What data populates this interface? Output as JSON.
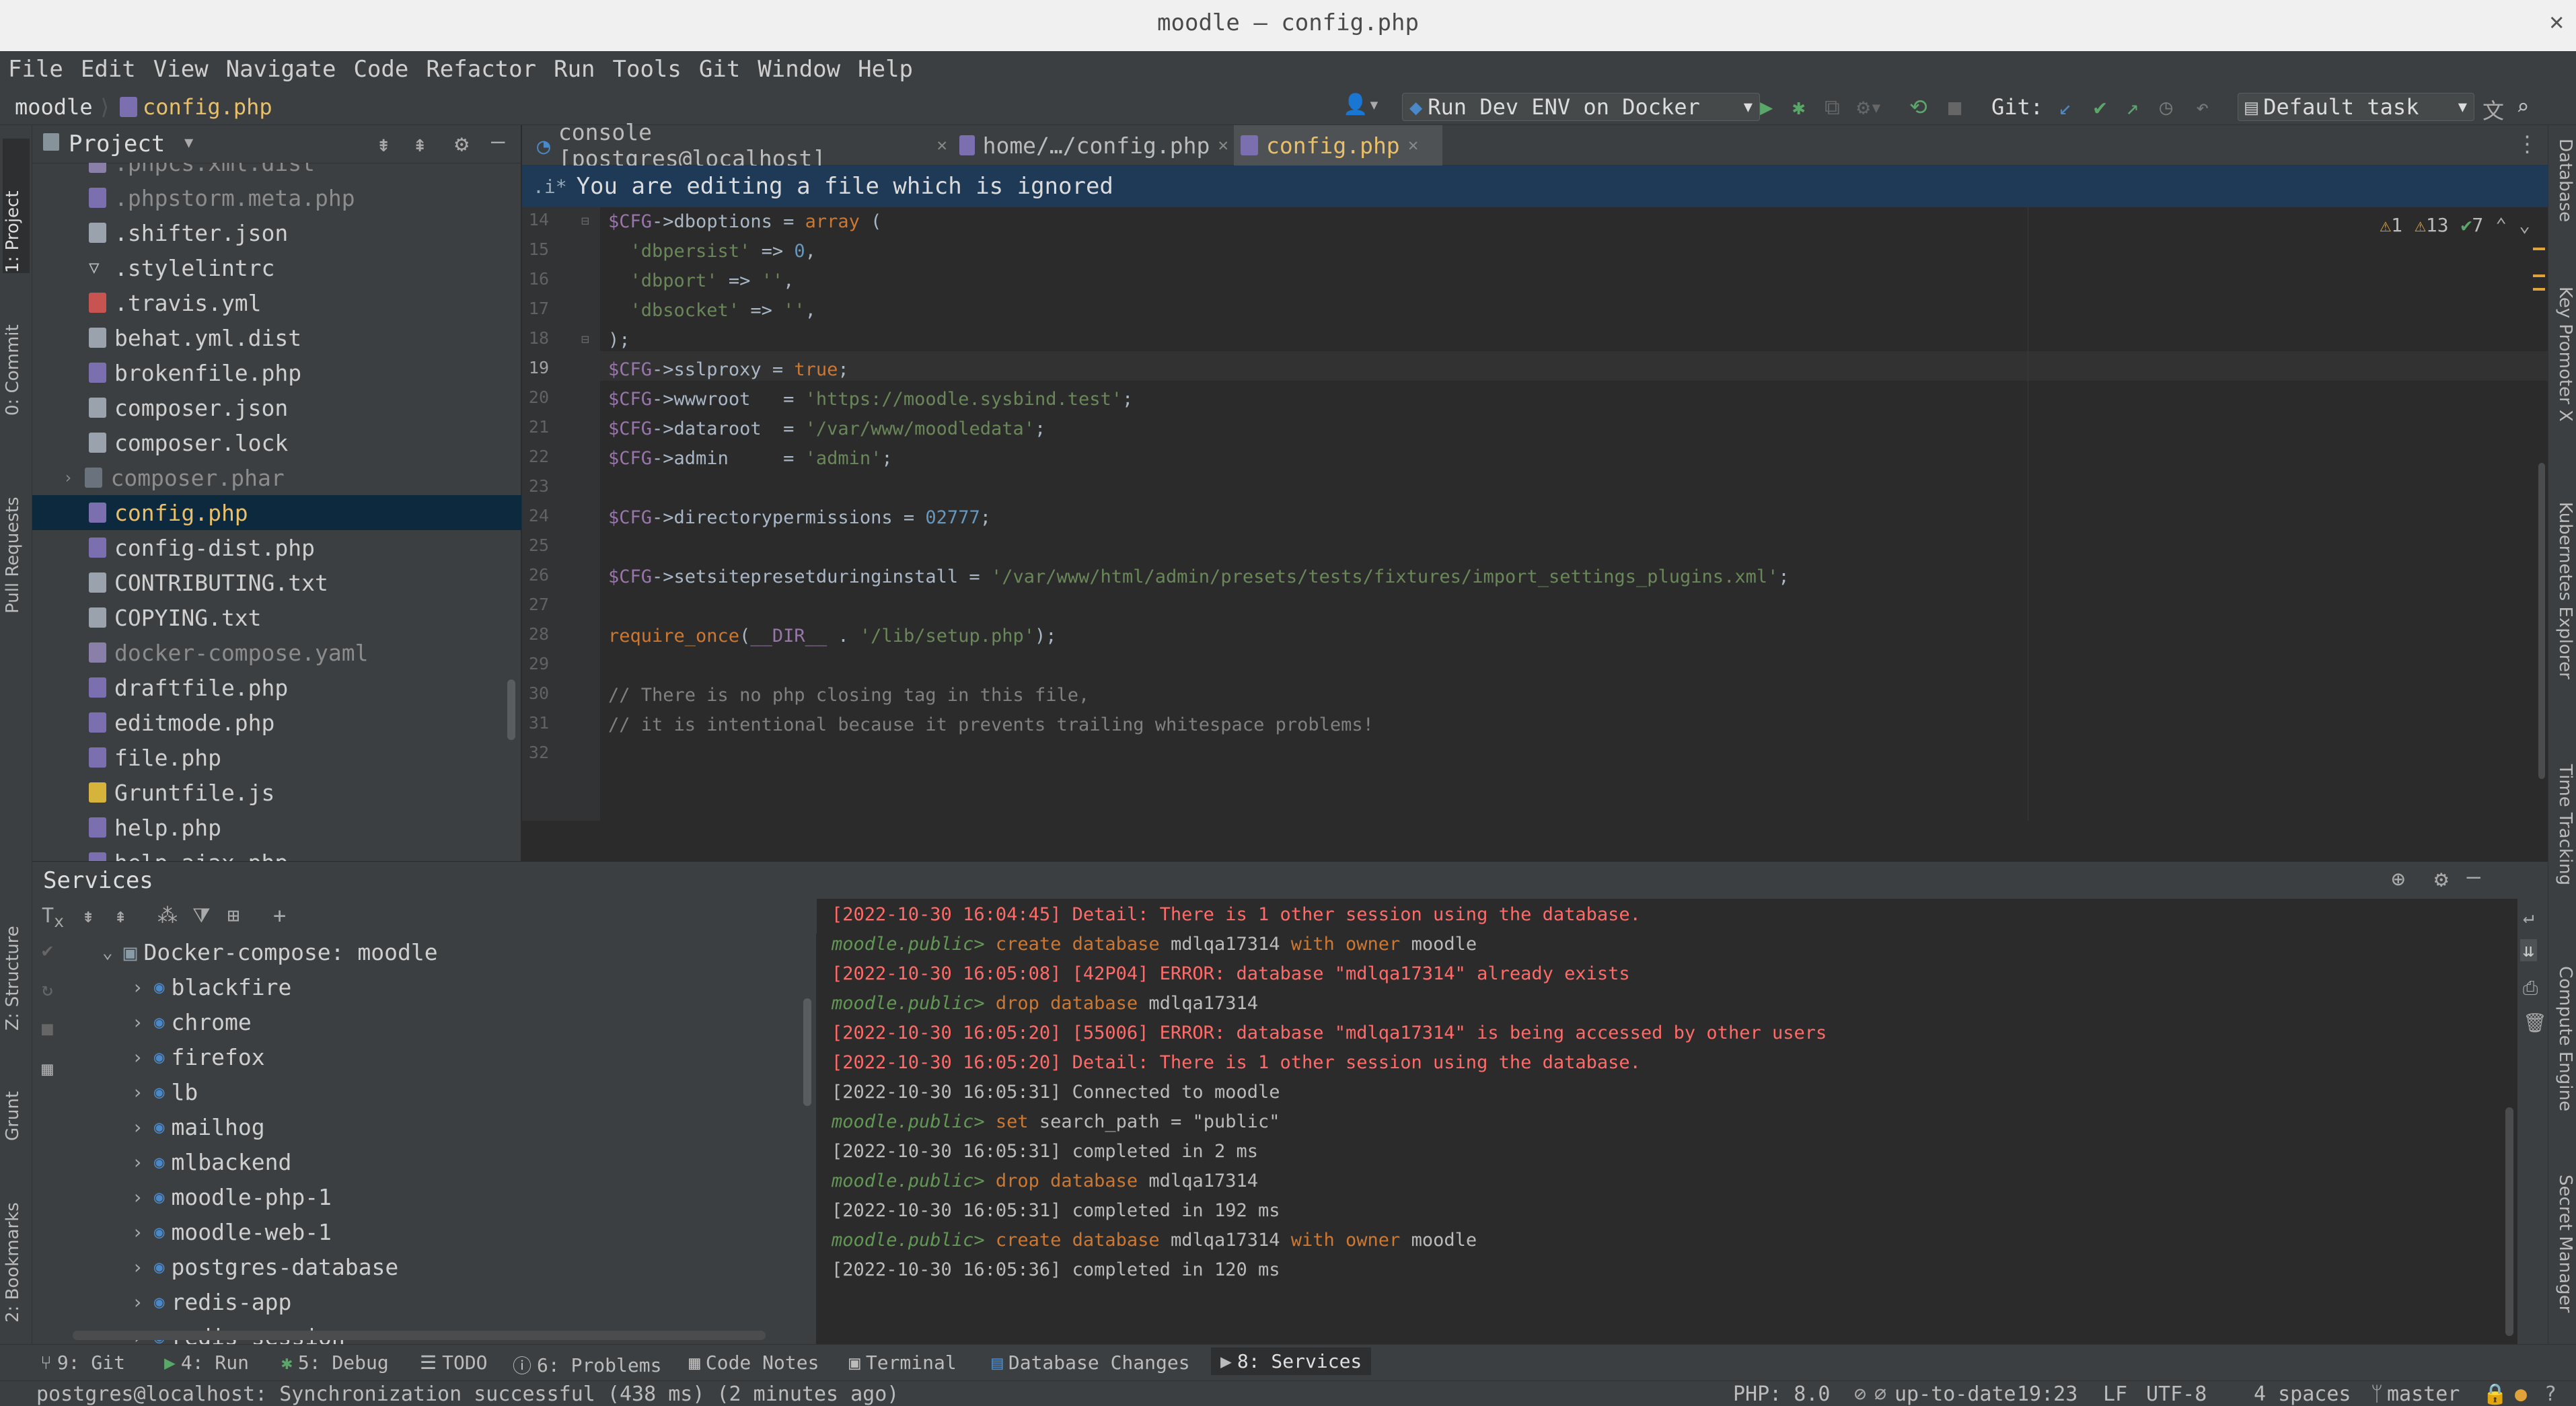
{
  "window": {
    "title": "moodle – config.php",
    "close": "✕"
  },
  "menu": [
    "File",
    "Edit",
    "View",
    "Navigate",
    "Code",
    "Refactor",
    "Run",
    "Tools",
    "Git",
    "Window",
    "Help"
  ],
  "nav": {
    "breadcrumb_root": "moodle",
    "breadcrumb_file": "config.php",
    "run_config": "Run Dev ENV on Docker",
    "git_label": "Git:",
    "task": "Default task"
  },
  "left_tool_tabs": [
    "1: Project",
    "0: Commit",
    "Pull Requests",
    "Z: Structure",
    "Grunt",
    "2: Bookmarks"
  ],
  "right_tool_tabs": [
    "Database",
    "Key Promoter X",
    "Kubernetes Explorer",
    "Time Tracking",
    "Compute Engine",
    "Secret Manager"
  ],
  "project": {
    "title": "Project",
    "files": [
      {
        "name": ".phpcs.xml.dist",
        "dim": true
      },
      {
        "name": ".phpstorm.meta.php",
        "dim": true
      },
      {
        "name": ".shifter.json",
        "dim": false
      },
      {
        "name": ".stylelintrc",
        "dim": false
      },
      {
        "name": ".travis.yml",
        "dim": false
      },
      {
        "name": "behat.yml.dist",
        "dim": false
      },
      {
        "name": "brokenfile.php",
        "dim": false
      },
      {
        "name": "composer.json",
        "dim": false
      },
      {
        "name": "composer.lock",
        "dim": false
      },
      {
        "name": "composer.phar",
        "dim": true
      },
      {
        "name": "config.php",
        "dim": false,
        "selected": true
      },
      {
        "name": "config-dist.php",
        "dim": false
      },
      {
        "name": "CONTRIBUTING.txt",
        "dim": false
      },
      {
        "name": "COPYING.txt",
        "dim": false
      },
      {
        "name": "docker-compose.yaml",
        "dim": true
      },
      {
        "name": "draftfile.php",
        "dim": false
      },
      {
        "name": "editmode.php",
        "dim": false
      },
      {
        "name": "file.php",
        "dim": false
      },
      {
        "name": "Gruntfile.js",
        "dim": false
      },
      {
        "name": "help.php",
        "dim": false
      },
      {
        "name": "help_ajax.php",
        "dim": false
      }
    ]
  },
  "editor": {
    "tabs": [
      {
        "label": "console [postgres@localhost]",
        "active": false
      },
      {
        "label": "home/…/config.php",
        "active": false
      },
      {
        "label": "config.php",
        "active": true
      }
    ],
    "banner": "You are editing a file which is ignored",
    "inspections": {
      "errors": "1",
      "warnings": "13",
      "ok": "7"
    },
    "lines": [
      {
        "n": "14",
        "code": [
          [
            "v",
            "$CFG"
          ],
          [
            "p",
            "->"
          ],
          [
            "p",
            "dboptions = "
          ],
          [
            "k",
            "array"
          ],
          [
            "p",
            " ("
          ]
        ]
      },
      {
        "n": "15",
        "code": [
          [
            "p",
            "  "
          ],
          [
            "s",
            "'dbpersist'"
          ],
          [
            "p",
            " => "
          ],
          [
            "n",
            "0"
          ],
          [
            "p",
            ","
          ]
        ]
      },
      {
        "n": "16",
        "code": [
          [
            "p",
            "  "
          ],
          [
            "s",
            "'dbport'"
          ],
          [
            "p",
            " => "
          ],
          [
            "s",
            "''"
          ],
          [
            "p",
            ","
          ]
        ]
      },
      {
        "n": "17",
        "code": [
          [
            "p",
            "  "
          ],
          [
            "s",
            "'dbsocket'"
          ],
          [
            "p",
            " => "
          ],
          [
            "s",
            "''"
          ],
          [
            "p",
            ","
          ]
        ]
      },
      {
        "n": "18",
        "code": [
          [
            "p",
            ");"
          ]
        ]
      },
      {
        "n": "19",
        "code": [
          [
            "v",
            "$CFG"
          ],
          [
            "p",
            "->sslproxy = "
          ],
          [
            "k",
            "true"
          ],
          [
            "p",
            ";"
          ]
        ]
      },
      {
        "n": "20",
        "code": [
          [
            "v",
            "$CFG"
          ],
          [
            "p",
            "->wwwroot   = "
          ],
          [
            "s",
            "'https://moodle.sysbind.test'"
          ],
          [
            "p",
            ";"
          ]
        ]
      },
      {
        "n": "21",
        "code": [
          [
            "v",
            "$CFG"
          ],
          [
            "p",
            "->dataroot  = "
          ],
          [
            "s",
            "'/var/www/moodledata'"
          ],
          [
            "p",
            ";"
          ]
        ]
      },
      {
        "n": "22",
        "code": [
          [
            "v",
            "$CFG"
          ],
          [
            "p",
            "->admin     = "
          ],
          [
            "s",
            "'admin'"
          ],
          [
            "p",
            ";"
          ]
        ]
      },
      {
        "n": "23",
        "code": []
      },
      {
        "n": "24",
        "code": [
          [
            "v",
            "$CFG"
          ],
          [
            "p",
            "->directorypermissions = "
          ],
          [
            "n",
            "02777"
          ],
          [
            "p",
            ";"
          ]
        ]
      },
      {
        "n": "25",
        "code": []
      },
      {
        "n": "26",
        "code": [
          [
            "v",
            "$CFG"
          ],
          [
            "p",
            "->setsitepresetduringinstall = "
          ],
          [
            "s",
            "'/var/www/html/admin/presets/tests/fixtures/import_settings_plugins.xml'"
          ],
          [
            "p",
            ";"
          ]
        ]
      },
      {
        "n": "27",
        "code": []
      },
      {
        "n": "28",
        "code": [
          [
            "k",
            "require_once"
          ],
          [
            "p",
            "("
          ],
          [
            "v",
            "__DIR__"
          ],
          [
            "p",
            " . "
          ],
          [
            "s",
            "'/lib/setup.php'"
          ],
          [
            "p",
            ");"
          ]
        ]
      },
      {
        "n": "29",
        "code": []
      },
      {
        "n": "30",
        "code": [
          [
            "c",
            "// There is no php closing tag in this file,"
          ]
        ]
      },
      {
        "n": "31",
        "code": [
          [
            "c",
            "// it is intentional because it prevents trailing whitespace problems!"
          ]
        ]
      },
      {
        "n": "32",
        "code": []
      }
    ]
  },
  "services": {
    "title": "Services",
    "root": "Docker-compose: moodle",
    "containers": [
      "blackfire",
      "chrome",
      "firefox",
      "lb",
      "mailhog",
      "mlbackend",
      "moodle-php-1",
      "moodle-web-1",
      "postgres-database",
      "redis-app",
      "redis-session"
    ],
    "console": [
      [
        [
          "err",
          "[2022-10-30 16:04:45] Detail: There is 1 other session using the database."
        ]
      ],
      [
        [
          "prm",
          "moodle.public> "
        ],
        [
          "kw",
          "create database "
        ],
        [
          "ok",
          "mdlqa17314 "
        ],
        [
          "kw",
          "with owner "
        ],
        [
          "ok",
          "moodle"
        ]
      ],
      [
        [
          "err",
          "[2022-10-30 16:05:08] [42P04] ERROR: database \"mdlqa17314\" already exists"
        ]
      ],
      [
        [
          "prm",
          "moodle.public> "
        ],
        [
          "kw",
          "drop database "
        ],
        [
          "ok",
          "mdlqa17314"
        ]
      ],
      [
        [
          "err",
          "[2022-10-30 16:05:20] [55006] ERROR: database \"mdlqa17314\" is being accessed by other users"
        ]
      ],
      [
        [
          "err",
          "[2022-10-30 16:05:20] Detail: There is 1 other session using the database."
        ]
      ],
      [
        [
          "ok",
          "[2022-10-30 16:05:31] Connected to moodle"
        ]
      ],
      [
        [
          "prm",
          "moodle.public> "
        ],
        [
          "kw",
          "set "
        ],
        [
          "ok",
          "search_path = \"public\""
        ]
      ],
      [
        [
          "ok",
          "[2022-10-30 16:05:31] completed in 2 ms"
        ]
      ],
      [
        [
          "prm",
          "moodle.public> "
        ],
        [
          "kw",
          "drop database "
        ],
        [
          "ok",
          "mdlqa17314"
        ]
      ],
      [
        [
          "ok",
          "[2022-10-30 16:05:31] completed in 192 ms"
        ]
      ],
      [
        [
          "prm",
          "moodle.public> "
        ],
        [
          "kw",
          "create database "
        ],
        [
          "ok",
          "mdlqa17314 "
        ],
        [
          "kw",
          "with owner "
        ],
        [
          "ok",
          "moodle"
        ]
      ],
      [
        [
          "ok",
          "[2022-10-30 16:05:36] completed in 120 ms"
        ]
      ]
    ]
  },
  "bottom_tools": [
    {
      "key": "9",
      "label": "9: Git",
      "icon": "git-icon",
      "active": false
    },
    {
      "key": "4",
      "label": "4: Run",
      "icon": "run-icon",
      "active": false
    },
    {
      "key": "5",
      "label": "5: Debug",
      "icon": "debug-icon",
      "active": false
    },
    {
      "key": "",
      "label": "TODO",
      "icon": "todo-icon",
      "active": false
    },
    {
      "key": "6",
      "label": "6: Problems",
      "icon": "problems-icon",
      "active": false
    },
    {
      "key": "",
      "label": "Code Notes",
      "icon": "notes-icon",
      "active": false
    },
    {
      "key": "",
      "label": "Terminal",
      "icon": "terminal-icon",
      "active": false
    },
    {
      "key": "",
      "label": "Database Changes",
      "icon": "db-changes-icon",
      "active": false
    },
    {
      "key": "8",
      "label": "8: Services",
      "icon": "services-icon",
      "active": true
    }
  ],
  "status": {
    "message": "postgres@localhost: Synchronization successful (438 ms) (2 minutes ago)",
    "php": "PHP: 8.0",
    "vcs": "up-to-date",
    "position": "19:23",
    "line_sep": "LF",
    "encoding": "UTF-8",
    "indent": "4 spaces",
    "branch": "master"
  }
}
